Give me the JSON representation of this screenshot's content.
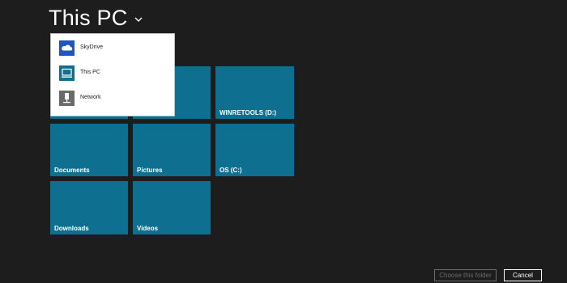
{
  "header": {
    "title": "This PC",
    "chevron_icon": "chevron-down-icon"
  },
  "location_menu": {
    "items": [
      {
        "label": "SkyDrive",
        "icon": "cloud-icon",
        "icon_bg": "#1f57c0"
      },
      {
        "label": "This PC",
        "icon": "computer-icon",
        "icon_bg": "#0f6f91"
      },
      {
        "label": "Network",
        "icon": "network-icon",
        "icon_bg": "#6a6a6a"
      }
    ]
  },
  "tiles": [
    {
      "label": ""
    },
    {
      "label": ""
    },
    {
      "label": "WINRETOOLS (D:)"
    },
    {
      "label": "Documents"
    },
    {
      "label": "Pictures"
    },
    {
      "label": "OS (C:)"
    },
    {
      "label": "Downloads"
    },
    {
      "label": "Videos"
    }
  ],
  "footer": {
    "choose_label": "Choose this folder",
    "cancel_label": "Cancel"
  },
  "colors": {
    "background": "#1d1d1d",
    "tile": "#0f6f91",
    "menu_background": "#ffffff"
  }
}
